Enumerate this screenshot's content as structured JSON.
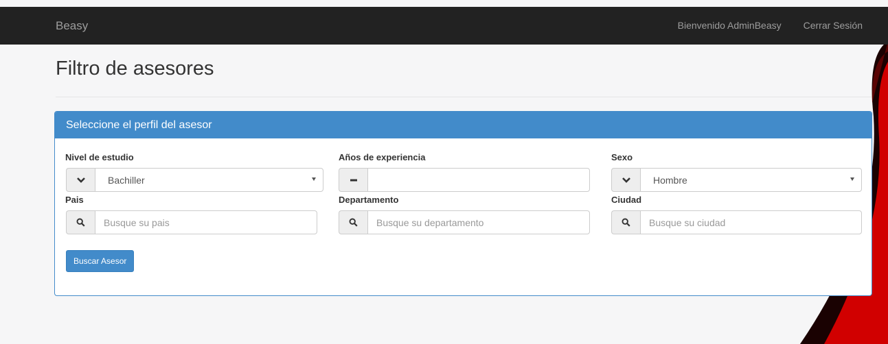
{
  "navbar": {
    "brand": "Beasy",
    "welcome": "Bienvenido AdminBeasy",
    "logout": "Cerrar Sesión"
  },
  "page": {
    "title": "Filtro de asesores"
  },
  "panel": {
    "heading": "Seleccione el perfil del asesor",
    "fields": {
      "nivel": {
        "label": "Nivel de estudio",
        "value": "Bachiller",
        "icon": "chevron-down-icon"
      },
      "experiencia": {
        "label": "Años de experiencia",
        "value": "",
        "icon": "minus-icon"
      },
      "sexo": {
        "label": "Sexo",
        "value": "Hombre",
        "icon": "chevron-down-icon"
      },
      "pais": {
        "label": "Pais",
        "placeholder": "Busque su pais",
        "icon": "search-icon"
      },
      "departamento": {
        "label": "Departamento",
        "placeholder": "Busque su departamento",
        "icon": "search-icon"
      },
      "ciudad": {
        "label": "Ciudad",
        "placeholder": "Busque su ciudad",
        "icon": "search-icon"
      }
    },
    "submit_label": "Buscar Asesor"
  },
  "colors": {
    "navbar": "#222222",
    "primary": "#428bca",
    "accent_red": "#d10000"
  }
}
